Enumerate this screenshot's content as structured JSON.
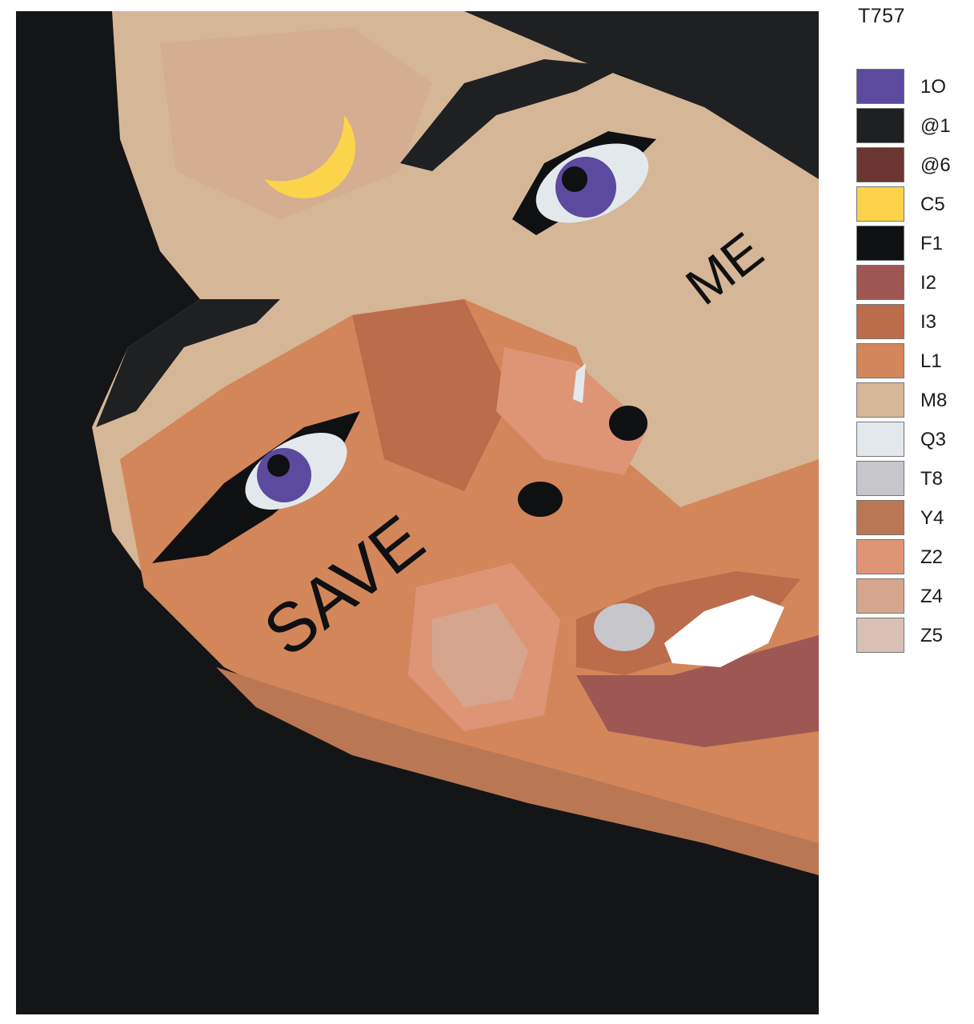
{
  "artwork": {
    "code": "T757",
    "face_text": {
      "left_cheek": "SAVE",
      "right_cheek": "ME"
    }
  },
  "palette": [
    {
      "label": "1O",
      "color": "#5b4a9d"
    },
    {
      "label": "@1",
      "color": "#1f2022"
    },
    {
      "label": "@6",
      "color": "#6b3531"
    },
    {
      "label": "C5",
      "color": "#fbd44b"
    },
    {
      "label": "F1",
      "color": "#0f1012"
    },
    {
      "label": "I2",
      "color": "#9f5754"
    },
    {
      "label": "I3",
      "color": "#bb6c4b"
    },
    {
      "label": "L1",
      "color": "#d3865a"
    },
    {
      "label": "M8",
      "color": "#d5b697"
    },
    {
      "label": "Q3",
      "color": "#e3e8ec"
    },
    {
      "label": "T8",
      "color": "#c7c6cb"
    },
    {
      "label": "Y4",
      "color": "#b97853"
    },
    {
      "label": "Z2",
      "color": "#de9576"
    },
    {
      "label": "Z4",
      "color": "#d5a68d"
    },
    {
      "label": "Z5",
      "color": "#d8c0b7"
    }
  ]
}
